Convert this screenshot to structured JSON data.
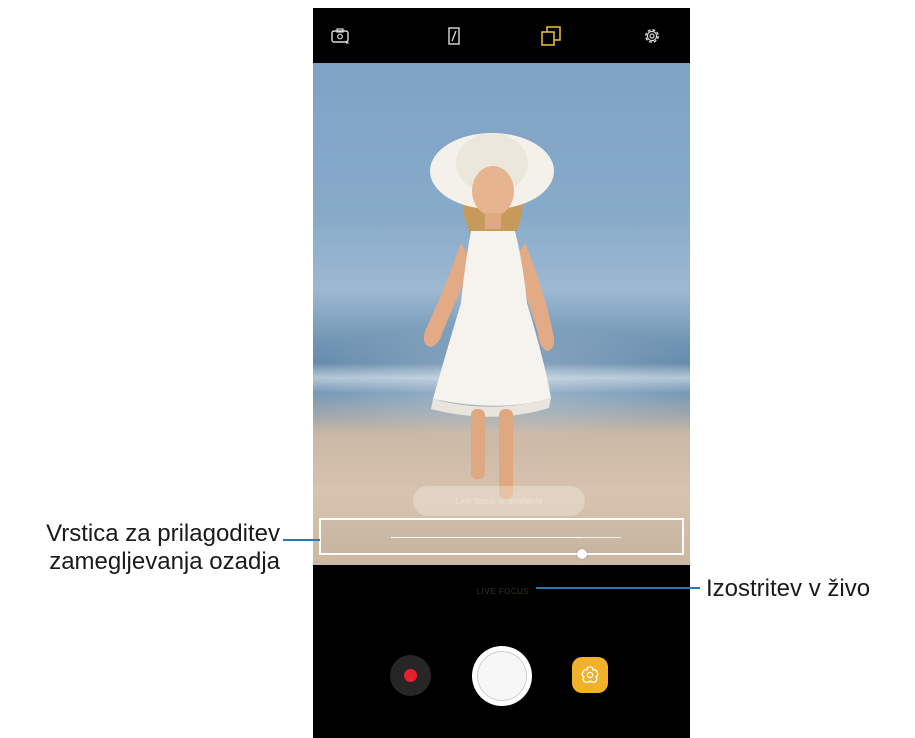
{
  "topbar": {
    "icons": [
      "camera-switch-icon",
      "flash-off-icon",
      "aspect-ratio-icon",
      "settings-gear-icon"
    ]
  },
  "viewfinder": {
    "focus_hint_text": "Live focus is available",
    "blur_level": 0.83
  },
  "bottom": {
    "mode_label": "LIVE FOCUS",
    "record_color": "#e8202a",
    "effects_color": "#f2b12a"
  },
  "callouts": {
    "blur_bar_label_line1": "Vrstica za prilagoditev",
    "blur_bar_label_line2": "zamegljevanja ozadja",
    "live_focus_label": "Izostritev v živo"
  },
  "colors": {
    "callout_line": "#2a7ab0"
  }
}
